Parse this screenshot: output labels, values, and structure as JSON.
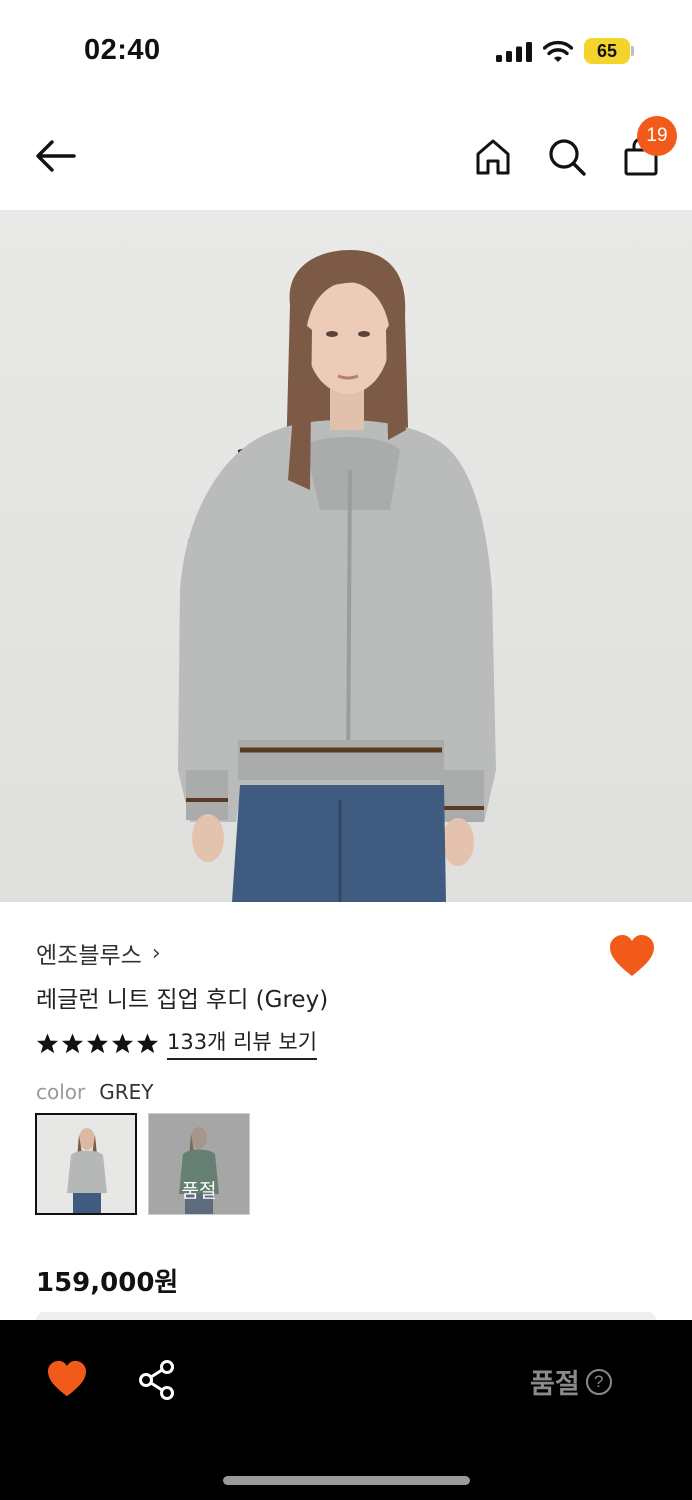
{
  "status_bar": {
    "time": "02:40",
    "battery": "65"
  },
  "header": {
    "cart_count": "19"
  },
  "product": {
    "brand": "엔조블루스",
    "brand_chevron": "›",
    "name": "레글런 니트 집업 후디 (Grey)",
    "rating_stars": 5,
    "review_link": "133개 리뷰 보기",
    "color_label": "color",
    "color_value": "GREY",
    "swatches": [
      {
        "name": "grey",
        "status": ""
      },
      {
        "name": "green",
        "status": "품절"
      }
    ],
    "price": "159,000원"
  },
  "bottom_bar": {
    "soldout_label": "품절",
    "help_symbol": "?"
  },
  "colors": {
    "accent": "#F25A1A",
    "bottom_bar_bg": "#000000",
    "battery": "#F4D42A"
  },
  "icons": {
    "back": "arrow-left-icon",
    "home": "home-icon",
    "search": "search-icon",
    "bag": "shopping-bag-icon",
    "wish": "heart-icon",
    "share": "share-icon",
    "help": "question-circle-icon"
  }
}
